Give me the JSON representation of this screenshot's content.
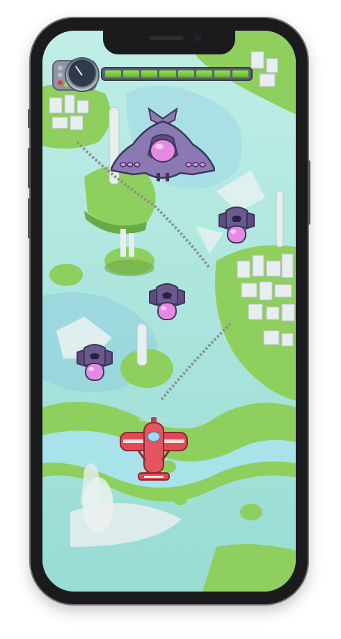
{
  "hud": {
    "health": {
      "segments_total": 8,
      "segments_filled": 8,
      "color": "#7dcc3f"
    },
    "gauge": {
      "icon": "speedometer-icon"
    },
    "lamps": [
      "#e23a3a",
      "#8fd94c",
      "#f2c230"
    ]
  },
  "enemies": {
    "boss": {
      "icon": "purple-mothership-icon"
    },
    "drones": [
      {
        "icon": "purple-drone-icon"
      },
      {
        "icon": "purple-drone-icon"
      },
      {
        "icon": "purple-drone-icon"
      }
    ]
  },
  "player": {
    "icon": "red-biplane-icon",
    "color": "#e04a55"
  },
  "colors": {
    "water": "#a9e4d9",
    "grass": "#8fcf5d",
    "boss": "#7d6a9e",
    "pod": "#e08ae0"
  }
}
